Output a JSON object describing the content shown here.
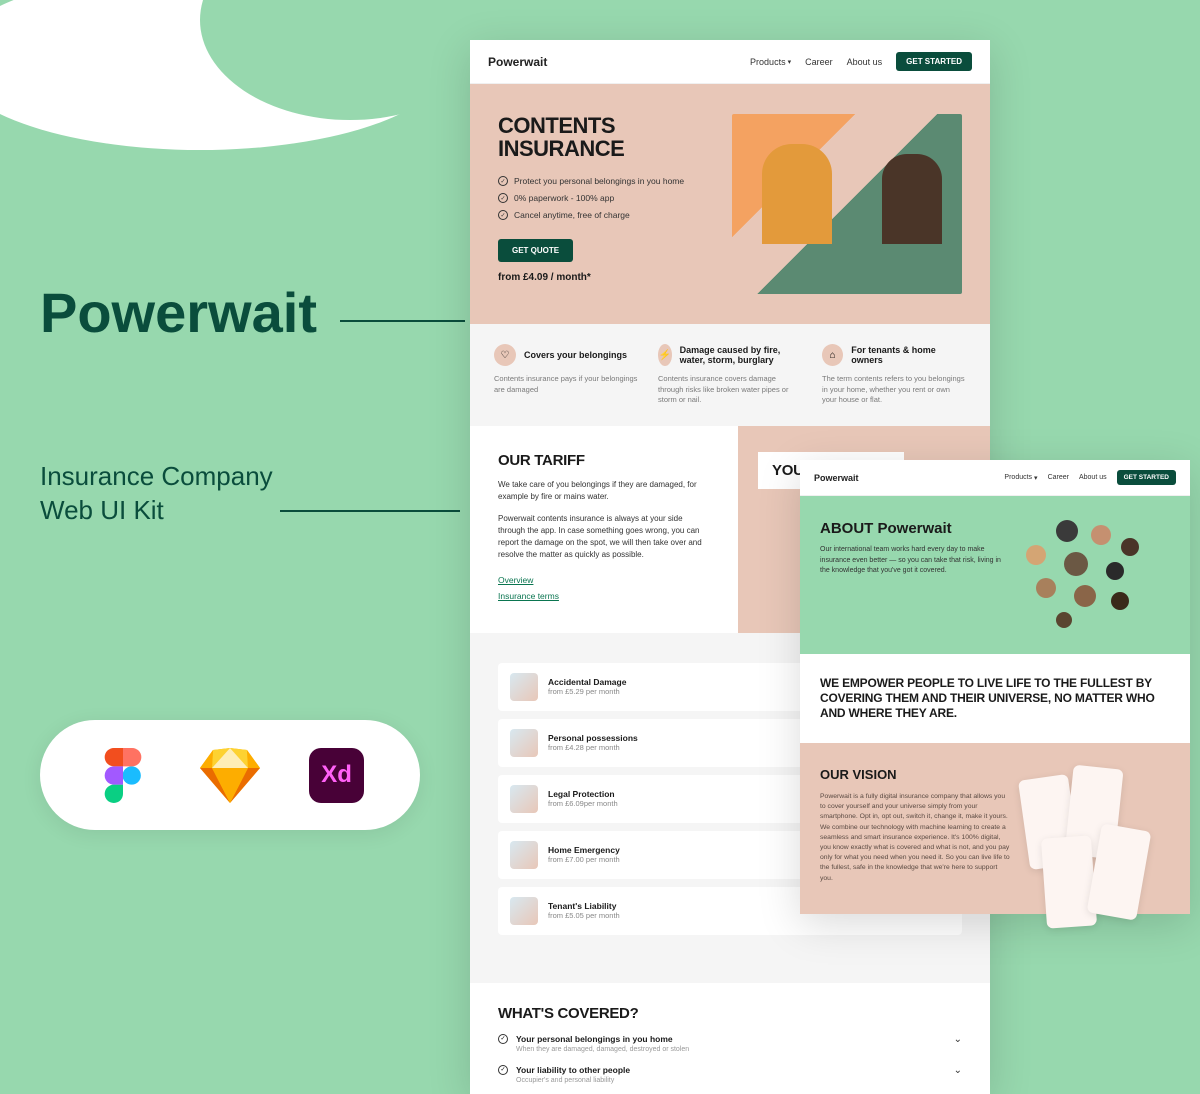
{
  "promo": {
    "title": "Powerwait",
    "subtitle": "Insurance Company\nWeb UI Kit"
  },
  "tools": [
    "Figma",
    "Sketch",
    "Adobe XD"
  ],
  "mockup1": {
    "logo": "Powerwait",
    "nav": {
      "products": "Products",
      "career": "Career",
      "about": "About us",
      "cta": "GET STARTED"
    },
    "hero": {
      "title": "CONTENTS\nINSURANCE",
      "features": [
        "Protect you personal belongings in you home",
        "0% paperwork - 100% app",
        "Cancel anytime, free of charge"
      ],
      "cta": "GET QUOTE",
      "price": "from £4.09 / month*"
    },
    "features3": [
      {
        "icon": "♡",
        "title": "Covers your belongings",
        "desc": "Contents insurance pays if your belongings are damaged"
      },
      {
        "icon": "⚡",
        "title": "Damage caused by fire, water, storm, burglary",
        "desc": "Contents insurance covers damage through risks like broken water pipes or storm or nail."
      },
      {
        "icon": "⌂",
        "title": "For tenants & home owners",
        "desc": "The term contents refers to you belongings in your home, whether you rent or own your house or flat."
      }
    ],
    "tariff": {
      "title": "OUR TARIFF",
      "p1": "We take care of you belongings if they are damaged, for example by fire or mains water.",
      "p2": "Powerwait contents insurance is always at your side through the app. In case something goes wrong, you can report the damage on the spot, we will then take over and resolve the matter as quickly as possible.",
      "links": [
        "Overview",
        "Insurance terms"
      ],
      "benefits_title": "YOUR BENEFITS"
    },
    "tariff_items": [
      {
        "title": "Accidental Damage",
        "sub": "from £5.29 per month"
      },
      {
        "title": "Personal possessions",
        "sub": "from £4.28 per month"
      },
      {
        "title": "Legal Protection",
        "sub": "from £6.09per month"
      },
      {
        "title": "Home Emergency",
        "sub": "from £7.00 per month"
      },
      {
        "title": "Tenant's Liability",
        "sub": "from £5.05 per month"
      }
    ],
    "covered": {
      "title": "WHAT'S COVERED?",
      "items": [
        {
          "title": "Your personal belongings in you home",
          "sub": "When they are damaged, damaged, destroyed or stolen"
        },
        {
          "title": "Your liability to other people",
          "sub": "Occupier's and personal liability"
        }
      ]
    }
  },
  "mockup2": {
    "logo": "Powerwait",
    "nav": {
      "products": "Products",
      "career": "Career",
      "about": "About us",
      "cta": "GET STARTED"
    },
    "about": {
      "title": "ABOUT Powerwait",
      "desc": "Our international team works hard every day to make insurance even better — so you can take that risk, living in the knowledge that you've got it covered."
    },
    "empower": "WE EMPOWER PEOPLE TO LIVE LIFE TO THE FULLEST BY COVERING THEM AND THEIR UNIVERSE, NO MATTER WHO AND WHERE THEY ARE.",
    "vision": {
      "title": "OUR VISION",
      "desc": "Powerwait is a fully digital insurance company that allows you to cover yourself and your universe simply from your smartphone. Opt in, opt out, switch it, change it, make it yours. We combine our technology with machine learning to create a seamless and smart insurance experience. It's 100% digital, you know exactly what is covered and what is not, and you pay only for what you need when you need it. So you can live life to the fullest, safe in the knowledge that we're here to support you."
    }
  }
}
